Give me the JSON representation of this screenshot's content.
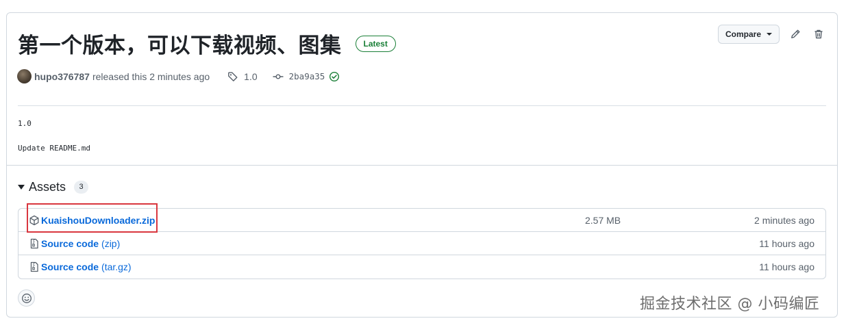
{
  "release": {
    "title": "第一个版本，可以下载视频、图集",
    "badge": "Latest",
    "author": "hupo376787",
    "released_text": "released this 2 minutes ago",
    "tag": "1.0",
    "commit": "2ba9a35",
    "body_lines": [
      "1.0",
      "Update README.md"
    ]
  },
  "actions": {
    "compare_label": "Compare",
    "edit_icon": "pencil-icon",
    "delete_icon": "trash-icon"
  },
  "assets": {
    "title": "Assets",
    "count": "3",
    "items": [
      {
        "name": "KuaishouDownloader.zip",
        "ext": "",
        "icon": "package-icon",
        "size": "2.57 MB",
        "time": "2 minutes ago"
      },
      {
        "name": "Source code",
        "ext": "(zip)",
        "icon": "file-zip-icon",
        "size": "",
        "time": "11 hours ago"
      },
      {
        "name": "Source code",
        "ext": "(tar.gz)",
        "icon": "file-zip-icon",
        "size": "",
        "time": "11 hours ago"
      }
    ]
  },
  "watermark": "掘金技术社区 @ 小码编匠",
  "colors": {
    "link": "#0969da",
    "success": "#1a7f37",
    "border": "#d0d7de",
    "highlight": "#d9363e"
  }
}
